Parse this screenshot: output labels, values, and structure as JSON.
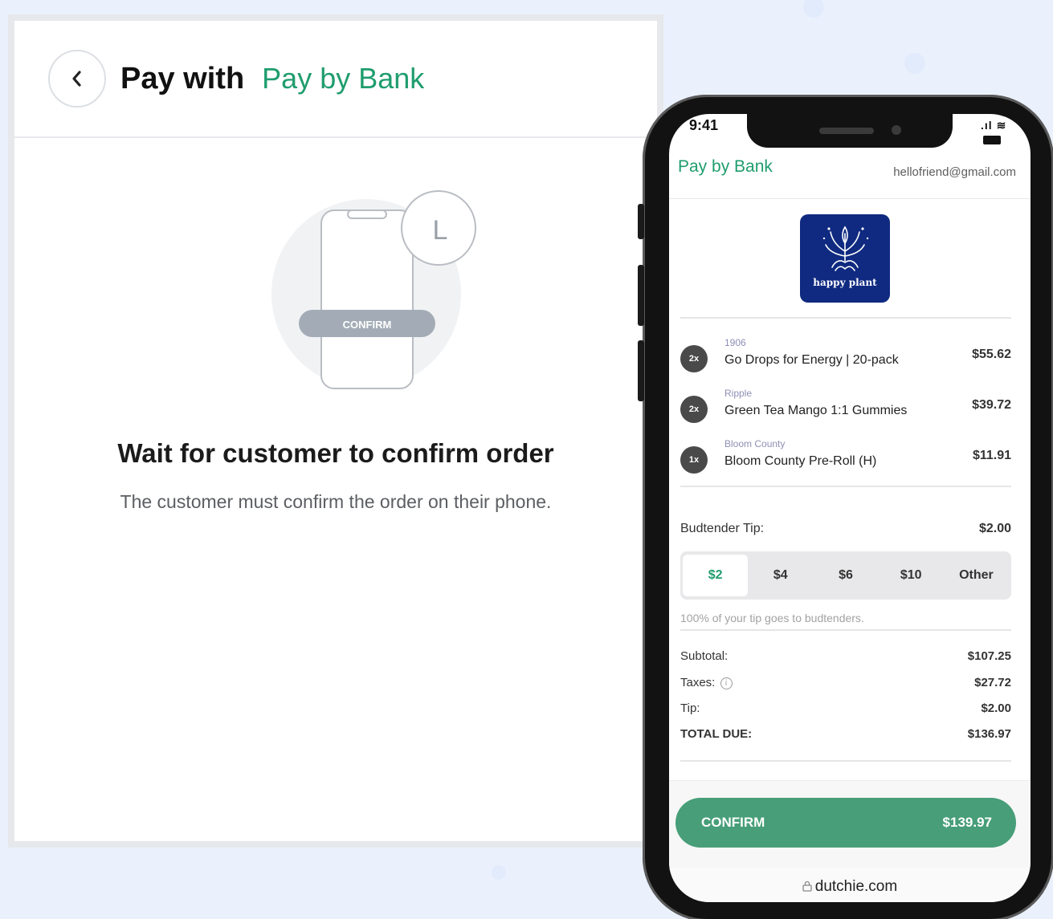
{
  "pos": {
    "title": "Pay with",
    "method": "Pay by Bank",
    "illustration_button": "CONFIRM",
    "clock_glyph": "L",
    "heading": "Wait for customer to confirm order",
    "subtitle": "The customer must confirm the order on their phone."
  },
  "phone": {
    "status_time": "9:41",
    "brand": "Pay by Bank",
    "email": "hellofriend@gmail.com",
    "logo_text": "happy plant",
    "items": [
      {
        "qty": "2x",
        "brand": "1906",
        "name": "Go Drops for Energy | 20-pack",
        "price": "$55.62"
      },
      {
        "qty": "2x",
        "brand": "Ripple",
        "name": "Green Tea Mango 1:1 Gummies",
        "price": "$39.72"
      },
      {
        "qty": "1x",
        "brand": "Bloom County",
        "name": "Bloom County Pre-Roll (H)",
        "price": "$11.91"
      }
    ],
    "tip_label": "Budtender Tip:",
    "tip_amount": "$2.00",
    "tip_options": [
      "$2",
      "$4",
      "$6",
      "$10",
      "Other"
    ],
    "tip_selected": "$2",
    "tip_note": "100% of your tip goes to budtenders.",
    "summary": {
      "subtotal_label": "Subtotal:",
      "subtotal": "$107.25",
      "taxes_label": "Taxes:",
      "taxes": "$27.72",
      "tip_label": "Tip:",
      "tip": "$2.00",
      "total_label": "TOTAL DUE:",
      "total": "$136.97"
    },
    "confirm_label": "CONFIRM",
    "confirm_amount": "$139.97",
    "url": "dutchie.com"
  },
  "colors": {
    "accent_green": "#1f9d6e",
    "confirm_green": "#479e78",
    "logo_navy": "#0f2a80",
    "background": "#eaf1fd"
  },
  "icons": [
    "back-chevron-icon",
    "clock-icon",
    "signal-icon",
    "wifi-icon",
    "battery-icon",
    "info-icon",
    "lock-icon",
    "cannabis-leaf-icon"
  ]
}
